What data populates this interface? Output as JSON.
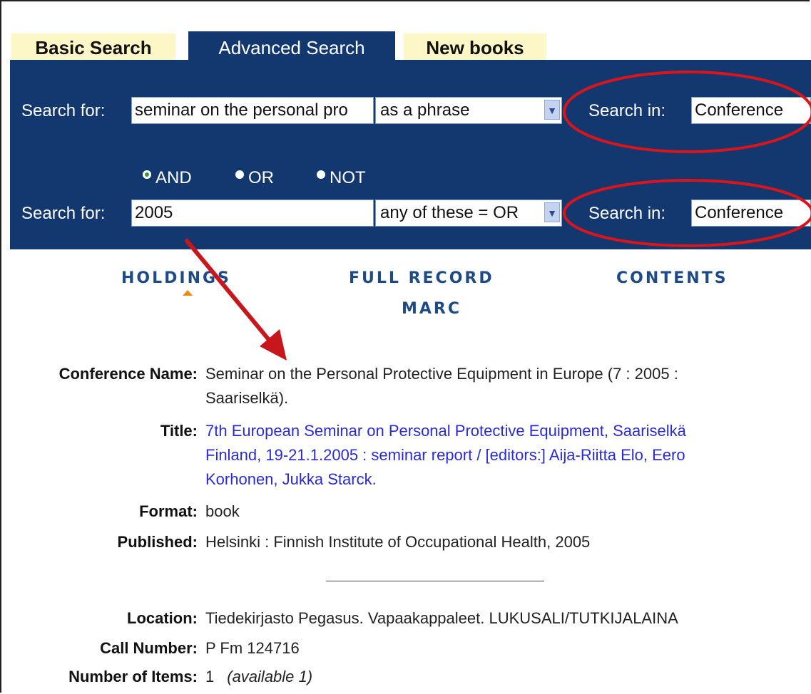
{
  "tabs": {
    "basic": "Basic Search",
    "advanced": "Advanced Search",
    "new_books": "New books"
  },
  "search": {
    "row1": {
      "label": "Search for:",
      "value": "seminar on the personal pro",
      "mode": "as a phrase",
      "in_label": "Search in:",
      "in_value": "Conference"
    },
    "operators": [
      "AND",
      "OR",
      "NOT"
    ],
    "operator_selected": "AND",
    "row2": {
      "label": "Search for:",
      "value": "2005",
      "mode": "any of these = OR",
      "in_label": "Search in:",
      "in_value": "Conference"
    }
  },
  "nav": {
    "holdings": "HOLDINGS",
    "full_record": "FULL RECORD",
    "contents": "CONTENTS",
    "marc": "MARC"
  },
  "record": {
    "conference_label": "Conference Name:",
    "conference_line1": "Seminar on the Personal Protective Equipment in Europe (7 : 2005 :",
    "conference_line2": "Saariselkä).",
    "title_label": "Title:",
    "title_line1": "7th European Seminar on Personal Protective Equipment, Saariselkä",
    "title_line2": "Finland, 19-21.1.2005 : seminar report / [editors:] Aija-Riitta Elo, Eero",
    "title_line3": "Korhonen, Jukka Starck.",
    "format_label": "Format:",
    "format_value": "book",
    "published_label": "Published:",
    "published_value": "Helsinki : Finnish Institute of Occupational Health, 2005",
    "location_label": "Location:",
    "location_value": "Tiedekirjasto Pegasus. Vapaakappaleet. LUKUSALI/TUTKIJALAINA",
    "callnumber_label": "Call Number:",
    "callnumber_value": "P Fm 124716",
    "items_label": "Number of Items:",
    "items_value": "1",
    "items_available": "(available 1)"
  },
  "colors": {
    "panel": "#13386f",
    "tab_inactive": "#fdf7c8",
    "annotation": "#d9151b",
    "link": "#2b2bd6"
  }
}
